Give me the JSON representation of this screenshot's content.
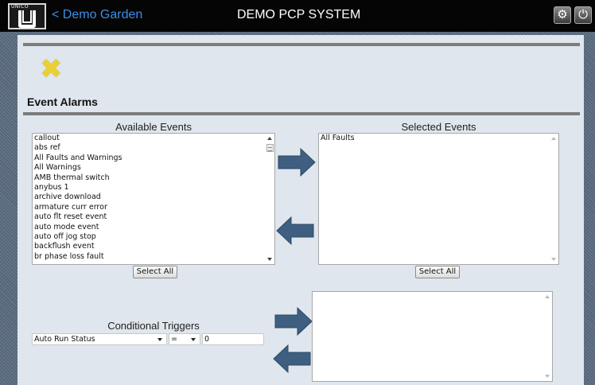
{
  "header": {
    "logo_text": "UNICO",
    "back_link": "< Demo Garden",
    "title": "DEMO PCP SYSTEM"
  },
  "page": {
    "section_title": "Event Alarms"
  },
  "available_events": {
    "label": "Available Events",
    "items": [
      "callout",
      "abs ref",
      "All Faults and Warnings",
      "All Warnings",
      "AMB thermal switch",
      "anybus 1",
      "archive download",
      "armature curr error",
      "auto flt reset event",
      "auto mode event",
      "auto off jog stop",
      "backflush event",
      "br phase loss fault"
    ],
    "select_all": "Select All"
  },
  "selected_events": {
    "label": "Selected Events",
    "items": [
      "All Faults"
    ],
    "select_all": "Select All"
  },
  "conditional_triggers": {
    "label": "Conditional Triggers",
    "field": "Auto Run Status",
    "operator": "=",
    "value": "0"
  },
  "colors": {
    "arrow": "#3e5f80",
    "back_link": "#3a8ee8",
    "close_icon": "#e9d033"
  }
}
